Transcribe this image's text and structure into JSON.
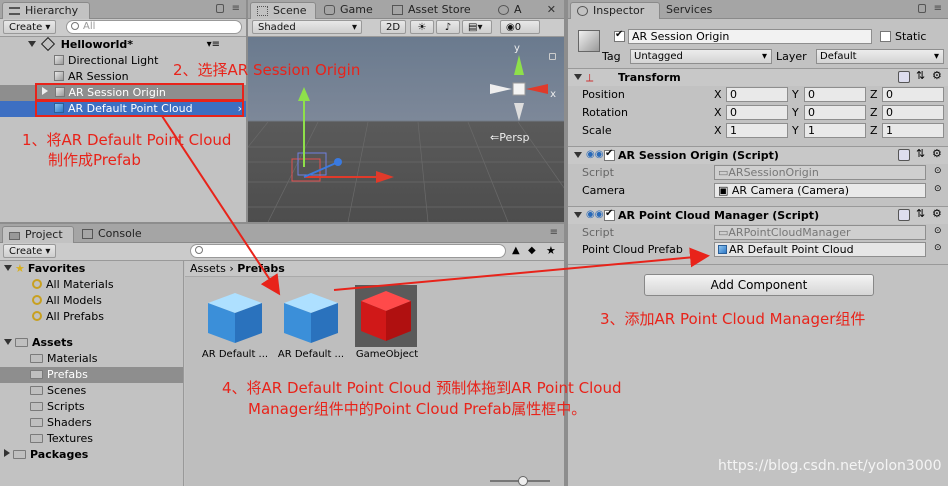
{
  "hierarchy": {
    "tab": "Hierarchy",
    "create": "Create",
    "search_placeholder": "All",
    "scene_name": "Helloworld*",
    "items": [
      {
        "label": "Directional Light"
      },
      {
        "label": "AR Session"
      },
      {
        "label": "AR Session Origin"
      },
      {
        "label": "AR Default Point Cloud"
      }
    ]
  },
  "scene": {
    "tabs": [
      "Scene",
      "Game",
      "Asset Store",
      "A"
    ],
    "shading": "Shaded",
    "mode_2d": "2D",
    "gizmo_count": "0",
    "persp_label": "Persp",
    "gizmo_axes": {
      "x": "x",
      "y": "y"
    }
  },
  "project": {
    "tabs": [
      "Project",
      "Console"
    ],
    "create": "Create",
    "favorites_label": "Favorites",
    "favorites": [
      "All Materials",
      "All Models",
      "All Prefabs"
    ],
    "assets_label": "Assets",
    "folders": [
      "Materials",
      "Prefabs",
      "Scenes",
      "Scripts",
      "Shaders",
      "Textures"
    ],
    "packages_label": "Packages",
    "breadcrumb": [
      "Assets",
      "Prefabs"
    ],
    "grid_items": [
      {
        "label": "AR Default ..."
      },
      {
        "label": "AR Default ..."
      },
      {
        "label": "GameObject"
      }
    ]
  },
  "inspector": {
    "tabs": [
      "Inspector",
      "Services"
    ],
    "object_name": "AR Session Origin",
    "static_label": "Static",
    "tag_label": "Tag",
    "tag_value": "Untagged",
    "layer_label": "Layer",
    "layer_value": "Default",
    "transform": {
      "title": "Transform",
      "rows": [
        {
          "label": "Position",
          "x": "0",
          "y": "0",
          "z": "0"
        },
        {
          "label": "Rotation",
          "x": "0",
          "y": "0",
          "z": "0"
        },
        {
          "label": "Scale",
          "x": "1",
          "y": "1",
          "z": "1"
        }
      ],
      "axis_labels": [
        "X",
        "Y",
        "Z"
      ]
    },
    "session_origin": {
      "title": "AR Session Origin (Script)",
      "script_label": "Script",
      "script_value": "ARSessionOrigin",
      "camera_label": "Camera",
      "camera_value": "AR Camera (Camera)"
    },
    "point_cloud_manager": {
      "title": "AR Point Cloud Manager (Script)",
      "script_label": "Script",
      "script_value": "ARPointCloudManager",
      "prefab_label": "Point Cloud Prefab",
      "prefab_value": "AR Default Point Cloud"
    },
    "add_component": "Add Component"
  },
  "annotations": {
    "step1_line1": "1、将AR Default Point Cloud",
    "step1_line2": "制作成Prefab",
    "step2": "2、选择AR Session Origin",
    "step3": "3、添加AR Point Cloud Manager组件",
    "step4_line1": "4、将AR Default Point Cloud 预制体拖到AR Point Cloud",
    "step4_line2": "Manager组件中的Point Cloud Prefab属性框中。"
  },
  "watermark": "https://blog.csdn.net/yolon3000",
  "colors": {
    "annotation_red": "#e8231a",
    "selection_blue": "#3d6fc2",
    "panel_gray": "#c2c2c2"
  }
}
